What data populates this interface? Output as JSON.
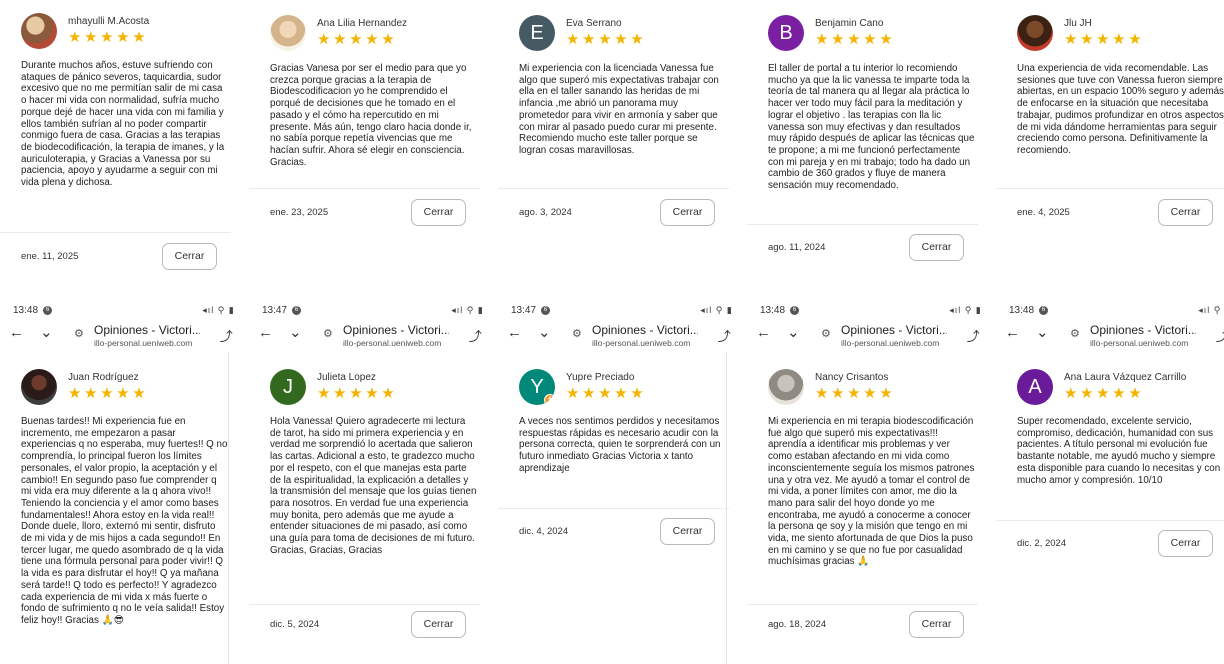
{
  "button_label": "Cerrar",
  "accent_colors": {
    "stars": "#f4b400"
  },
  "browser": {
    "page_title": "Opiniones - Victori...",
    "url": "illo-personal.ueniweb.com",
    "icons": {
      "back": "arrow-left-icon",
      "collapse": "chevron-down-icon",
      "settings": "tune-icon",
      "share": "share-icon"
    }
  },
  "status_bar_times": [
    "13:48",
    "13:47",
    "13:47",
    "13:48",
    "13:48"
  ],
  "status_badge": "6",
  "status_icons": "◂ıl ⚲ ▮",
  "avatar_letters": {
    "eva": "E",
    "benjamin": "B",
    "julieta": "J",
    "yupre": "Y",
    "ana_laura": "A"
  },
  "avatar_colors": {
    "eva": "#465a64",
    "benjamin": "#7b1fa2",
    "julieta": "#33691e",
    "yupre": "#00897b",
    "ana_laura": "#6a1b9a"
  },
  "stars": "★★★★★",
  "rating": 5,
  "reviews": {
    "mhayulli": {
      "name": "mhayulli M.Acosta",
      "text": "Durante muchos años, estuve sufriendo con ataques de pánico severos, taquicardia, sudor excesivo que no me permitían salir de mi casa o hacer mi vida con normalidad, sufría mucho porque dejé de hacer una vida con mi familia y ellos también sufrían al no poder compartir conmigo fuera de casa. Gracias a las terapias de biodecodificación, la terapia de imanes, y la auriculoterapia, y Gracias a Vanessa por su paciencia, apoyo y ayudarme a seguir con mi vida plena y dichosa.",
      "date": "ene. 11, 2025"
    },
    "ana_lilia": {
      "name": "Ana Lilia Hernandez",
      "text": "Gracias Vanesa por ser el medio para que yo crezca porque gracias a la terapia de Biodescodificacion yo he comprendido el porqué de decisiones que he tomado en el pasado y el cómo ha repercutido en mi presente. Más aún, tengo claro hacia donde ir, no sabía porque repetía vivencias que me hacían sufrir. Ahora sé elegir en consciencia. Gracias.",
      "date": "ene. 23, 2025"
    },
    "eva": {
      "name": "Eva Serrano",
      "text": "Mi experiencia con la licenciada Vanessa fue algo que superó mis expectativas trabajar con ella en el taller sanando las heridas de mi infancia ,me abrió un panorama muy prometedor para vivir en armonía y saber que con mirar al pasado puedo curar mi presente. Recomiendo mucho este taller porque se logran cosas maravillosas.",
      "date": "ago. 3, 2024"
    },
    "benjamin": {
      "name": "Benjamin Cano",
      "text": "El taller de portal a tu interior lo recomiendo mucho ya que la lic vanessa te imparte toda la teoría de tal manera qu al llegar ala práctica lo hacer ver todo muy fácil para la meditación y lograr el objetivo . las terapias con lla lic vanessa son muy efectivas y dan resultados muy rápido después de aplicar las técnicas que te propone; a mi me funcionó perfectamente con mi pareja y en mi trabajo; todo ha dado un cambio de 360 grados y fluye de manera sensación muy recomendado.",
      "date": "ago. 11, 2024"
    },
    "jlu": {
      "name": "Jlu JH",
      "text": "Una experiencia de vida recomendable. Las sesiones que tuve con Vanessa fueron siempre abiertas, en un espacio 100% seguro y además de enfocarse en la situación que necesitaba trabajar, pudimos profundizar en otros aspectos de mi vida dándome herramientas para seguir creciendo como persona. Definitivamente la recomiendo.",
      "date": "ene. 4, 2025"
    },
    "juan": {
      "name": "Juan Rodríguez",
      "text": "Buenas tardes!! Mi experiencia fue en incremento, me empezaron a pasar experiencias q no esperaba, muy fuertes!! Q no comprendía, lo principal fueron los límites personales, el valor propio, la aceptación y el cambio!! En segundo paso fue comprender q mi vida era muy diferente a la q ahora vivo!! Teniendo la conciencia y el amor como bases fundamentales!! Ahora estoy en la vida real!! Donde duele, lloro, externó mi sentir, disfruto de mi vida y de mis hijos a cada segundo!! En tercer lugar, me quedo asombrado de q la vida tiene una fórmula personal para poder vivir!! Q la vida es para disfrutar el hoy!! Q ya mañana será tarde!! Q todo es perfecto!! Y agradezco cada experiencia de mi vida x más fuerte o fondo de sufrimiento q no le veía salida!! Estoy feliz hoy!! Gracias 🙏😎"
    },
    "julieta": {
      "name": "Julieta Lopez",
      "text": "Hola Vanessa! Quiero agradecerte mi lectura de tarot, ha sido mi primera experiencia y en verdad me sorprendió lo acertada que salieron las cartas. Adicional a esto, te gradezco mucho por el respeto, con el que manejas esta parte de la espiritualidad, la explicación a detalles y la transmisión del mensaje que los guías tienen para nosotros. En verdad fue una experiencia muy bonita, pero además que me ayude a entender situaciones de mi pasado, así como una guía para toma de decisiones de mi futuro. Gracias, Gracias, Gracias",
      "date": "dic. 5, 2024"
    },
    "yupre": {
      "name": "Yupre Preciado",
      "text": "A veces nos sentimos perdidos y necesitamos respuestas rápidas es necesario acudir con la persona correcta, quien te sorprenderá con un futuro inmediato Gracias Victoria x tanto aprendizaje",
      "date": "dic. 4, 2024"
    },
    "nancy": {
      "name": "Nancy Crisantos",
      "text": "Mi experiencia en mi terapia biodescodificación fue algo que superó mis expectativas!!! aprendía a identificar mis problemas y ver como estaban afectando en mi vida como inconscientemente seguía los mismos patrones una y otra vez. Me ayudó a tomar el control de mi vida, a poner límites con amor, me dio la mano para salir del hoyo donde yo me encontraba, me ayudó a conocerme a conocer la persona qe soy y la misión que tengo en mi vida, me siento afortunada de que Dios la puso en mi camino y se que no fue por casualidad muchísimas gracias 🙏",
      "date": "ago. 18, 2024"
    },
    "ana_laura": {
      "name": "Ana Laura Vázquez Carrillo",
      "text": "Super recomendado, excelente servicio, compromiso, dedicación, humanidad con sus pacientes. A título personal mi evolución fue bastante notable, me ayudó mucho y siempre esta disponible para cuando lo necesitas y con mucho amor y compresión. 10/10",
      "date": "dic. 2, 2024"
    }
  }
}
